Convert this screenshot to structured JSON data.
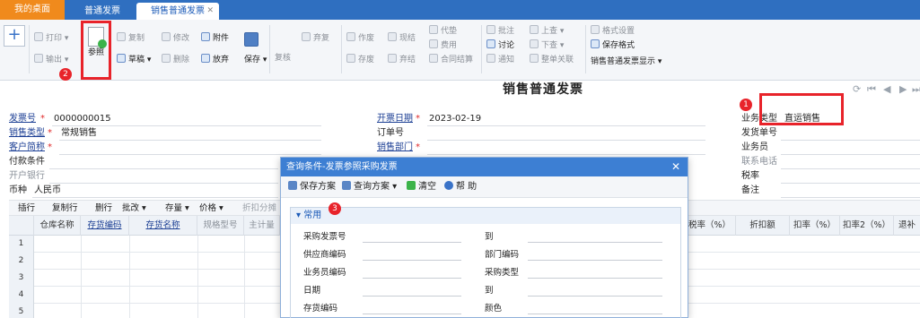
{
  "tabs": [
    {
      "label": "我的桌面"
    },
    {
      "label": "普通发票"
    },
    {
      "label": "销售普通发票"
    }
  ],
  "toolbar": {
    "print": "打印",
    "output": "输出",
    "reference": "参照",
    "copy": "复制",
    "draft": "草稿",
    "modify": "修改",
    "delete": "删除",
    "attach": "附件",
    "abandon": "放弃",
    "save": "保存",
    "review": "复核",
    "recheck": "弃复",
    "void1": "作废",
    "void2": "存废",
    "cash": "现结",
    "cash_cancel": "弃结",
    "substitute": "代垫",
    "expense": "费用",
    "contract": "合同结算",
    "note": "批注",
    "discuss": "讨论",
    "notify": "通知",
    "prev": "上查",
    "next": "下查",
    "doc_link": "整单关联",
    "format_set": "格式设置",
    "save_format": "保存格式",
    "display": "销售普通发票显示"
  },
  "badges": {
    "one": "1",
    "two": "2",
    "three": "3"
  },
  "page_title": "销售普通发票",
  "form": {
    "invoice_no_label": "发票号",
    "invoice_no": "0000000015",
    "open_date_label": "开票日期",
    "open_date": "2023-02-19",
    "biz_type_label": "业务类型",
    "biz_type": "直运销售",
    "sales_type_label": "销售类型",
    "sales_type": "常规销售",
    "order_no_label": "订单号",
    "ship_no_label": "发货单号",
    "customer_label": "客户简称",
    "dept_label": "销售部门",
    "salesman_label": "业务员",
    "payment_label": "付款条件",
    "phone_label": "联系电话",
    "bank_label": "开户银行",
    "tax_label": "税率",
    "currency_label": "币种",
    "currency": "人民币",
    "remark_label": "备注"
  },
  "grid_toolbar": {
    "insert": "插行",
    "copy_row": "复制行",
    "delete_row": "删行",
    "batch": "批改",
    "stock": "存量",
    "price": "价格",
    "discount_split": "折扣分摊"
  },
  "grid": {
    "columns": [
      "仓库名称",
      "存货编码",
      "存货名称",
      "规格型号",
      "主计量"
    ],
    "right_columns": [
      "税率（%）",
      "折扣额",
      "扣率（%）",
      "扣率2（%）",
      "退补"
    ],
    "rows": [
      "1",
      "2",
      "3",
      "4",
      "5"
    ]
  },
  "dialog": {
    "title": "查询条件-发票参照采购发票",
    "save_plan": "保存方案",
    "query_plan": "查询方案",
    "clear": "清空",
    "help": "帮 助",
    "section": "常用",
    "left_labels": [
      "采购发票号",
      "供应商编码",
      "业务员编码",
      "日期",
      "存货编码"
    ],
    "right_labels": [
      "到",
      "部门编码",
      "采购类型",
      "到",
      "颜色"
    ]
  }
}
